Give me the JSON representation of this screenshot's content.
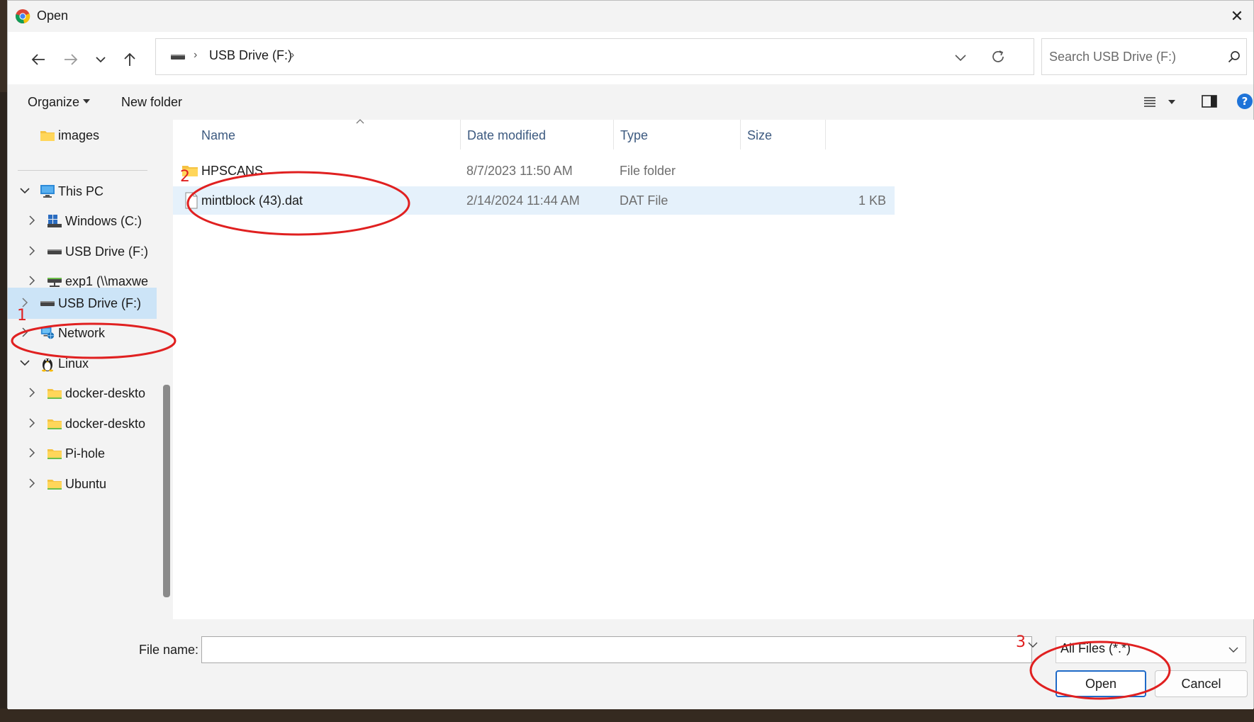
{
  "window": {
    "title": "Open",
    "close_glyph": "✕"
  },
  "address_bar": {
    "path": "USB Drive (F:)",
    "separator": "›"
  },
  "search": {
    "placeholder": "Search USB Drive (F:)"
  },
  "command_bar": {
    "organize_label": "Organize",
    "new_folder_label": "New folder"
  },
  "nav_pane": {
    "items": [
      {
        "label": "images",
        "icon": "folder-icon"
      },
      {
        "label": "This PC",
        "icon": "computer-icon"
      },
      {
        "label": "Windows (C:)",
        "icon": "windows-drive-icon"
      },
      {
        "label": "USB Drive (F:)",
        "icon": "usb-drive-icon"
      },
      {
        "label": "exp1 (\\\\maxwe",
        "icon": "network-drive-icon"
      },
      {
        "label": "USB Drive (F:)",
        "icon": "usb-drive-icon",
        "selected": true
      },
      {
        "label": "Network",
        "icon": "network-icon"
      },
      {
        "label": "Linux",
        "icon": "linux-icon"
      },
      {
        "label": "docker-deskto",
        "icon": "folder-icon"
      },
      {
        "label": "docker-deskto",
        "icon": "folder-icon"
      },
      {
        "label": "Pi-hole",
        "icon": "folder-icon"
      },
      {
        "label": "Ubuntu",
        "icon": "folder-icon"
      }
    ]
  },
  "file_list": {
    "columns": [
      "Name",
      "Date modified",
      "Type",
      "Size"
    ],
    "rows": [
      {
        "name": "HPSCANS",
        "date_modified": "8/7/2023 11:50 AM",
        "type": "File folder",
        "size": "",
        "icon": "folder-icon"
      },
      {
        "name": "mintblock (43).dat",
        "date_modified": "2/14/2024 11:44 AM",
        "type": "DAT File",
        "size": "1 KB",
        "icon": "file-icon",
        "selected": true
      }
    ]
  },
  "bottom_bar": {
    "file_name_label": "File name:",
    "file_name_value": "",
    "file_type_filter": "All Files (*.*)",
    "open_label": "Open",
    "cancel_label": "Cancel"
  },
  "annotations": {
    "step1": "1",
    "step2": "2",
    "step3": "3",
    "color": "#e02020"
  },
  "colors": {
    "accent": "#1e6ac8",
    "selection": "#cce4f7",
    "annotation": "#e02020"
  }
}
